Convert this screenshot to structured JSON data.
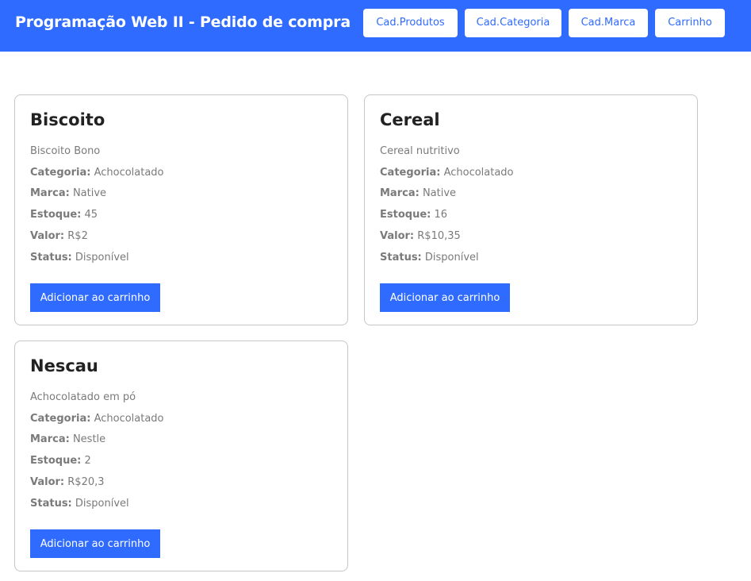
{
  "header": {
    "title": "Programação Web II - Pedido de compra",
    "nav": [
      {
        "label": "Cad.Produtos"
      },
      {
        "label": "Cad.Categoria"
      },
      {
        "label": "Cad.Marca"
      },
      {
        "label": "Carrinho"
      }
    ]
  },
  "colors": {
    "accent": "#2f6bff",
    "card_border": "#c6c6c6",
    "text_muted": "#7a7a7a",
    "title_text": "#222222"
  },
  "labels": {
    "category": "Categoria:",
    "brand": "Marca:",
    "stock": "Estoque:",
    "price": "Valor:",
    "status": "Status:"
  },
  "products": [
    {
      "name": "Biscoito",
      "description": "Biscoito Bono",
      "category": "Achocolatado",
      "brand": "Native",
      "stock": "45",
      "price": "R$2",
      "status": "Disponível",
      "button_label": "Adicionar ao carrinho"
    },
    {
      "name": "Cereal",
      "description": "Cereal nutritivo",
      "category": "Achocolatado",
      "brand": "Native",
      "stock": "16",
      "price": "R$10,35",
      "status": "Disponível",
      "button_label": "Adicionar ao carrinho"
    },
    {
      "name": "Nescau",
      "description": "Achocolatado em pó",
      "category": "Achocolatado",
      "brand": "Nestle",
      "stock": "2",
      "price": "R$20,3",
      "status": "Disponível",
      "button_label": "Adicionar ao carrinho"
    }
  ]
}
